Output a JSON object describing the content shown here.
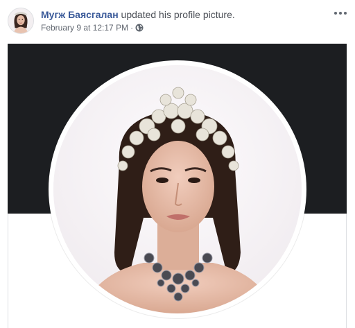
{
  "post": {
    "author_name": "Мугж Баясгалан",
    "action_text": "updated his profile picture.",
    "timestamp": "February 9 at 12:17 PM",
    "separator": "·",
    "privacy_icon": "globe-icon",
    "more_icon": "more-options-icon"
  },
  "colors": {
    "author_link": "#385898",
    "cover_background": "#1c1e21",
    "meta_text": "#616770"
  }
}
